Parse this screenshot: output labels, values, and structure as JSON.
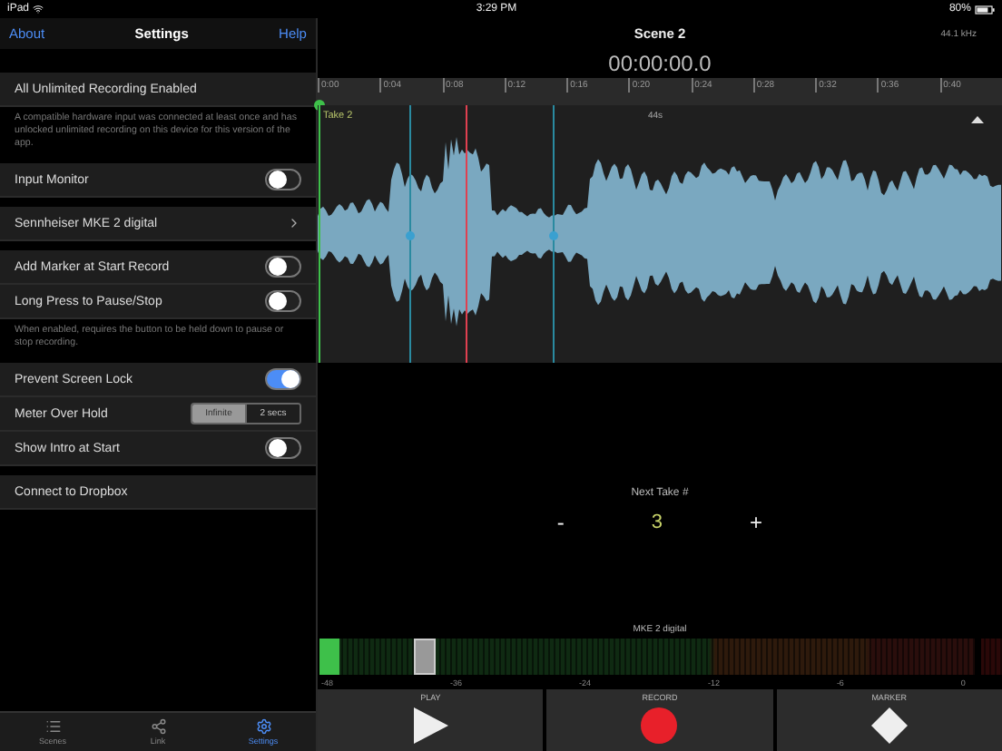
{
  "status_bar": {
    "device": "iPad",
    "time": "3:29 PM",
    "battery": "80%"
  },
  "settings": {
    "nav": {
      "left": "About",
      "title": "Settings",
      "right": "Help"
    },
    "sections": [
      {
        "rows": [
          {
            "kind": "label",
            "label": "All Unlimited Recording Enabled"
          }
        ],
        "footnote": "A compatible hardware input was connected at least once and has unlocked unlimited recording on this device for this version of the app."
      },
      {
        "rows": [
          {
            "kind": "toggle",
            "label": "Input Monitor",
            "on": false
          }
        ]
      },
      {
        "rows": [
          {
            "kind": "link",
            "label": "Sennheiser MKE 2 digital"
          }
        ]
      },
      {
        "rows": [
          {
            "kind": "toggle",
            "label": "Add Marker at Start Record",
            "on": false
          },
          {
            "kind": "toggle",
            "label": "Long Press to Pause/Stop",
            "on": false
          }
        ],
        "footnote": "When enabled, requires the button to be held down to pause or stop recording."
      },
      {
        "rows": [
          {
            "kind": "toggle",
            "label": "Prevent Screen Lock",
            "on": true
          },
          {
            "kind": "segmented",
            "label": "Meter Over Hold",
            "options": [
              {
                "label": "Infinite",
                "selected": true
              },
              {
                "label": "2 secs",
                "selected": false
              }
            ]
          },
          {
            "kind": "toggle",
            "label": "Show Intro at Start",
            "on": false
          }
        ]
      },
      {
        "rows": [
          {
            "kind": "label",
            "label": "Connect to Dropbox"
          }
        ]
      }
    ]
  },
  "tab_bar": [
    {
      "kind": "list",
      "label": "Scenes",
      "selected": false
    },
    {
      "kind": "share",
      "label": "Link",
      "selected": false
    },
    {
      "kind": "gear",
      "label": "Settings",
      "selected": true
    }
  ],
  "recorder": {
    "title": "Scene 2",
    "sample_rate": "44.1 kHz",
    "timecode": "00:00:00.0",
    "ruler": [
      "0:00",
      "0:04",
      "0:08",
      "0:12",
      "0:16",
      "0:20",
      "0:24",
      "0:28",
      "0:32",
      "0:36",
      "0:40"
    ],
    "take": {
      "name": "Take 2",
      "duration": "44s"
    },
    "next_take": {
      "label": "Next Take #",
      "decrement": "-",
      "value": "3",
      "increment": "+"
    },
    "meter": {
      "source": "MKE 2 digital",
      "level": 0.03,
      "scale": [
        "-48",
        "-36",
        "-24",
        "-12",
        "-6",
        "0"
      ]
    },
    "transport": [
      {
        "kind": "play",
        "label": "PLAY"
      },
      {
        "kind": "record",
        "label": "RECORD"
      },
      {
        "kind": "marker",
        "label": "MARKER"
      }
    ]
  }
}
